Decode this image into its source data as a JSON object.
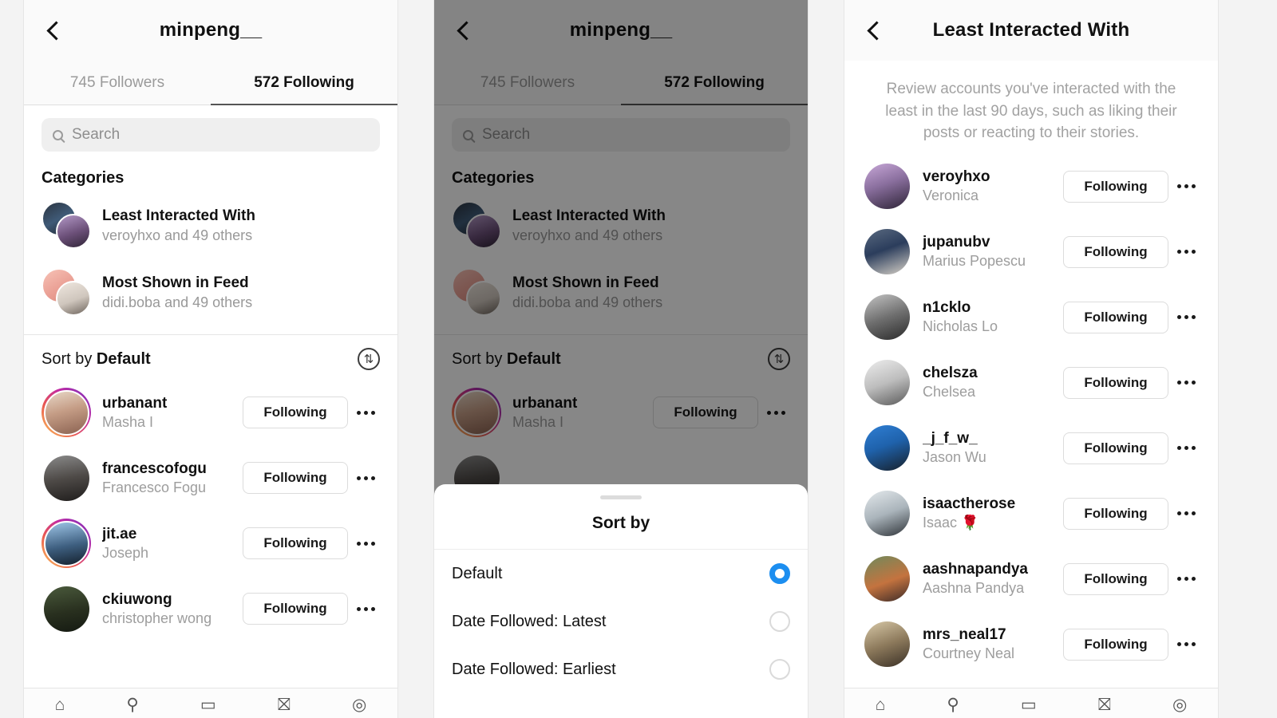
{
  "panel1": {
    "nav": {
      "back_icon": "chevron-left-icon",
      "title": "minpeng__"
    },
    "tabs": [
      {
        "label": "745 Followers",
        "active": false
      },
      {
        "label": "572 Following",
        "active": true
      }
    ],
    "search": {
      "placeholder": "Search",
      "icon": "search-icon"
    },
    "categories_heading": "Categories",
    "categories": [
      {
        "title": "Least Interacted With",
        "subtitle": "veroyhxo and 49 others"
      },
      {
        "title": "Most Shown in Feed",
        "subtitle": "didi.boba and 49 others"
      }
    ],
    "sort": {
      "prefix": "Sort by ",
      "value": "Default",
      "icon": "sort-arrows-icon"
    },
    "users": [
      {
        "username": "urbanant",
        "fullname": "Masha I",
        "button": "Following",
        "story": true
      },
      {
        "username": "francescofogu",
        "fullname": "Francesco Fogu",
        "button": "Following",
        "story": false
      },
      {
        "username": "jit.ae",
        "fullname": "Joseph",
        "button": "Following",
        "story": true
      },
      {
        "username": "ckiuwong",
        "fullname": "christopher wong",
        "button": "Following",
        "story": false
      }
    ]
  },
  "panel2": {
    "nav": {
      "back_icon": "chevron-left-icon",
      "title": "minpeng__"
    },
    "tabs": [
      {
        "label": "745 Followers",
        "active": false
      },
      {
        "label": "572 Following",
        "active": true
      }
    ],
    "search": {
      "placeholder": "Search",
      "icon": "search-icon"
    },
    "categories_heading": "Categories",
    "categories": [
      {
        "title": "Least Interacted With",
        "subtitle": "veroyhxo and 49 others"
      },
      {
        "title": "Most Shown in Feed",
        "subtitle": "didi.boba and 49 others"
      }
    ],
    "sort": {
      "prefix": "Sort by ",
      "value": "Default",
      "icon": "sort-arrows-icon"
    },
    "users": [
      {
        "username": "urbanant",
        "fullname": "Masha I",
        "button": "Following",
        "story": true
      }
    ],
    "sheet": {
      "title": "Sort by",
      "options": [
        {
          "label": "Default",
          "selected": true
        },
        {
          "label": "Date Followed: Latest",
          "selected": false
        },
        {
          "label": "Date Followed: Earliest",
          "selected": false
        }
      ]
    }
  },
  "panel3": {
    "nav": {
      "back_icon": "chevron-left-icon",
      "title": "Least Interacted With"
    },
    "description": "Review accounts you've interacted with the least in the last 90 days, such as liking their posts or reacting to their stories.",
    "users": [
      {
        "username": "veroyhxo",
        "fullname": "Veronica",
        "button": "Following"
      },
      {
        "username": "jupanubv",
        "fullname": "Marius Popescu",
        "button": "Following"
      },
      {
        "username": "n1cklo",
        "fullname": "Nicholas Lo",
        "button": "Following"
      },
      {
        "username": "chelsza",
        "fullname": "Chelsea",
        "button": "Following"
      },
      {
        "username": "_j_f_w_",
        "fullname": "Jason Wu",
        "button": "Following"
      },
      {
        "username": "isaactherose",
        "fullname": "Isaac 🌹",
        "button": "Following"
      },
      {
        "username": "aashnapandya",
        "fullname": "Aashna Pandya",
        "button": "Following"
      },
      {
        "username": "mrs_neal17",
        "fullname": "Courtney Neal",
        "button": "Following"
      }
    ]
  },
  "tabbar": {
    "items": [
      {
        "icon": "home-icon",
        "glyph": "⌂"
      },
      {
        "icon": "search-icon",
        "glyph": "⚲"
      },
      {
        "icon": "reels-icon",
        "glyph": "▭"
      },
      {
        "icon": "shop-icon",
        "glyph": "⛝"
      },
      {
        "icon": "profile-avatar-icon",
        "glyph": "◎"
      }
    ]
  },
  "colors": {
    "accent_blue": "#1c8ef0",
    "story_ring": "#c32aa3",
    "text_primary": "#111111",
    "text_secondary": "#9d9d9d",
    "panel_bg": "#ffffff",
    "page_bg": "#f3f3f3"
  }
}
